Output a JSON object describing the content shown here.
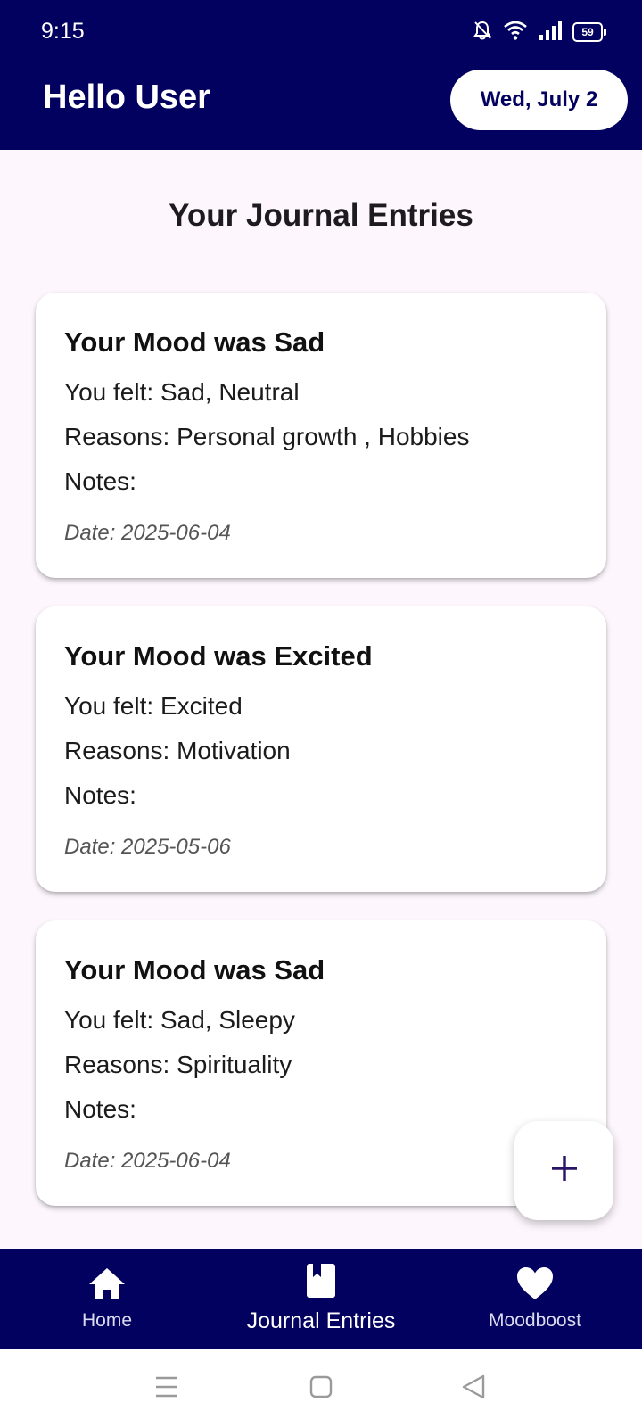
{
  "status_bar": {
    "time": "9:15",
    "battery": "59",
    "icons": [
      "bell-off-icon",
      "wifi-icon",
      "signal-icon",
      "battery-icon"
    ]
  },
  "header": {
    "greeting": "Hello User",
    "date_label": "Wed, July 2"
  },
  "page": {
    "title": "Your Journal Entries"
  },
  "entries": [
    {
      "title": "Your Mood was Sad",
      "felt": "You felt: Sad, Neutral",
      "reasons": "Reasons: Personal growth , Hobbies",
      "notes": "Notes:",
      "date": "Date: 2025-06-04"
    },
    {
      "title": "Your Mood was Excited",
      "felt": "You felt: Excited",
      "reasons": "Reasons: Motivation",
      "notes": "Notes:",
      "date": "Date: 2025-05-06"
    },
    {
      "title": "Your Mood was Sad",
      "felt": "You felt: Sad, Sleepy",
      "reasons": "Reasons: Spirituality",
      "notes": "Notes:",
      "date": "Date: 2025-06-04"
    }
  ],
  "fab": {
    "icon": "plus-icon"
  },
  "bottom_nav": {
    "items": [
      {
        "label": "Home",
        "icon": "home-icon"
      },
      {
        "label": "Journal Entries",
        "icon": "book-icon",
        "active": true
      },
      {
        "label": "Moodboost",
        "icon": "heart-icon"
      }
    ]
  },
  "colors": {
    "primary": "#03015f",
    "background": "#fdf7fd",
    "card": "#ffffff",
    "fab_icon": "#2a1466"
  }
}
